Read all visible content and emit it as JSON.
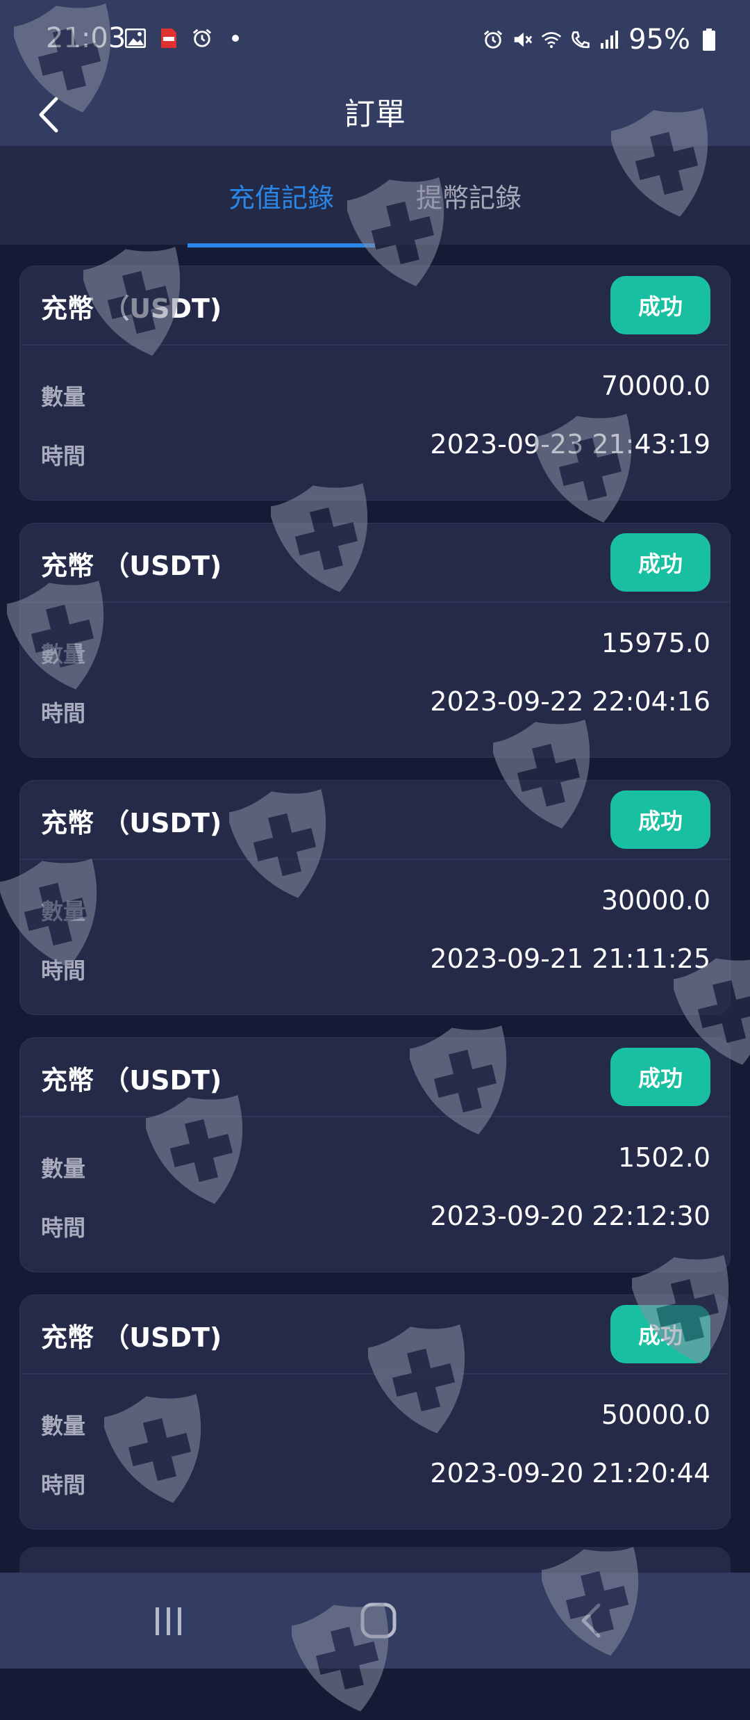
{
  "status_bar": {
    "time": "21:03",
    "left_icons": [
      "image-icon",
      "pdf-icon",
      "alarm-icon",
      "dot-icon"
    ],
    "right_icons": [
      "alarm-icon",
      "mute-icon",
      "wifi-icon",
      "call-icon",
      "signal-icon",
      "battery-icon"
    ],
    "battery": "95%"
  },
  "header": {
    "title": "訂單",
    "back_icon": "chevron-left-icon"
  },
  "tabs": [
    {
      "label": "充值記錄",
      "active": true
    },
    {
      "label": "提幣記錄",
      "active": false
    }
  ],
  "records": [
    {
      "title": "充幣 （USDT)",
      "status": "成功",
      "qty_label": "數量",
      "qty": "70000.0",
      "time_label": "時間",
      "time": "2023-09-23 21:43:19"
    },
    {
      "title": "充幣 （USDT)",
      "status": "成功",
      "qty_label": "數量",
      "qty": "15975.0",
      "time_label": "時間",
      "time": "2023-09-22 22:04:16"
    },
    {
      "title": "充幣 （USDT)",
      "status": "成功",
      "qty_label": "數量",
      "qty": "30000.0",
      "time_label": "時間",
      "time": "2023-09-21 21:11:25"
    },
    {
      "title": "充幣 （USDT)",
      "status": "成功",
      "qty_label": "數量",
      "qty": "1502.0",
      "time_label": "時間",
      "time": "2023-09-20 22:12:30"
    },
    {
      "title": "充幣 （USDT)",
      "status": "成功",
      "qty_label": "數量",
      "qty": "50000.0",
      "time_label": "時間",
      "time": "2023-09-20 21:20:44"
    }
  ],
  "bottom_nav": [
    "recent-apps-icon",
    "home-icon",
    "back-icon"
  ],
  "colors": {
    "accent": "#2a86e6",
    "success_badge": "#18c0a1",
    "background": "#151a35",
    "card": "#252a48",
    "header": "#333c61"
  }
}
